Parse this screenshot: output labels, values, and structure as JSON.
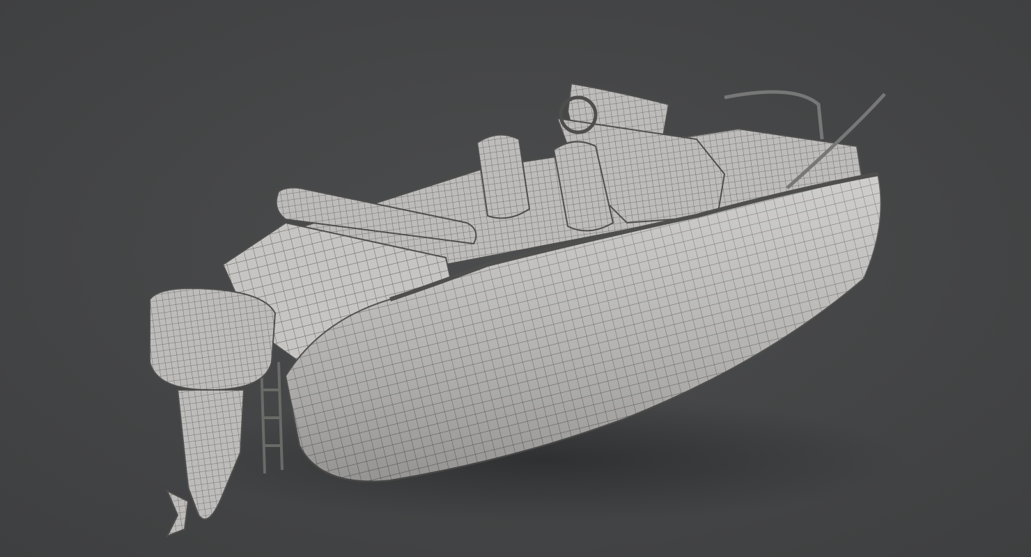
{
  "colors": {
    "background": "#444546",
    "hull": "#c9c8c6",
    "hull_shade": "#a9a8a6",
    "wire": "#5a5a58",
    "shadow": "#2f3031"
  }
}
